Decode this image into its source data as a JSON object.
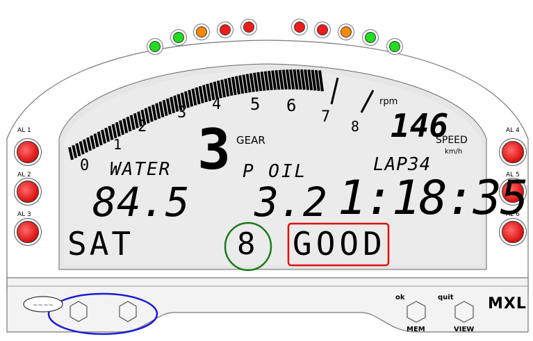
{
  "shift_lights": [
    {
      "color": "#22dd22"
    },
    {
      "color": "#22dd22"
    },
    {
      "color": "#ff8a00"
    },
    {
      "color": "#ee1c1c"
    },
    {
      "color": "#ee1c1c"
    },
    {
      "color": "#ee1c1c"
    },
    {
      "color": "#ee1c1c"
    },
    {
      "color": "#ff8a00"
    },
    {
      "color": "#22dd22"
    },
    {
      "color": "#22dd22"
    }
  ],
  "alarms": {
    "left": [
      "AL 1",
      "AL 2",
      "AL 3"
    ],
    "right": [
      "AL 4",
      "AL 5",
      "AL 6"
    ],
    "color": "#e01b1b"
  },
  "rpm": {
    "unit": "rpm",
    "ticks": [
      "0",
      "1",
      "2",
      "3",
      "4",
      "5",
      "6",
      "7",
      "8"
    ]
  },
  "gear": {
    "value": "3",
    "label": "GEAR"
  },
  "speed": {
    "value": "146",
    "label": "SPEED",
    "unit": "km/h"
  },
  "water": {
    "label": "WATER",
    "value": "84.5"
  },
  "oil": {
    "label": "P OIL",
    "value": "3.2"
  },
  "lap": {
    "label": "LAP34",
    "time": "1:18:35"
  },
  "bottom_row": {
    "left": "SAT",
    "center": "8",
    "right": "GOOD"
  },
  "highlights": {
    "green": "#1a7a1a",
    "red": "#dd1111",
    "blue": "#1a1ad8"
  },
  "controls": {
    "ok_label": "ok",
    "mem_label": "MEM",
    "quit_label": "quit",
    "view_label": "VIEW",
    "brand": "MXL"
  }
}
